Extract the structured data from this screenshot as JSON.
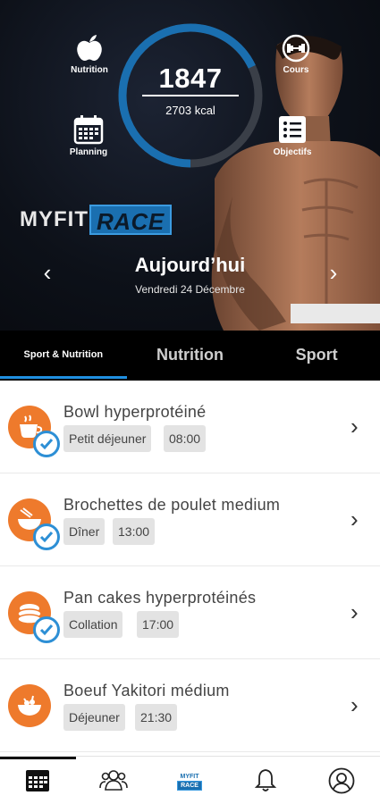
{
  "hero": {
    "calories_consumed": "1847",
    "calories_target": "2703 kcal",
    "progress_fraction": 0.68,
    "shortcuts": {
      "nutrition": "Nutrition",
      "planning": "Planning",
      "cours": "Cours",
      "objectifs": "Objectifs"
    },
    "brand": {
      "part1": "MYFIT",
      "part2": "RACE"
    },
    "day_title": "Aujourd’hui",
    "day_date": "Vendredi 24 Décembre"
  },
  "tabs": [
    {
      "label": "Sport & Nutrition",
      "active": true
    },
    {
      "label": "Nutrition",
      "active": false
    },
    {
      "label": "Sport",
      "active": false
    }
  ],
  "meals": [
    {
      "name": "Bowl hyperprotéiné",
      "type": "Petit déjeuner",
      "time": "08:00",
      "done": true,
      "icon": "cup-icon"
    },
    {
      "name": "Brochettes de poulet medium",
      "type": "Dîner",
      "time": "13:00",
      "done": true,
      "icon": "bowl-icon"
    },
    {
      "name": "Pan cakes hyperprotéinés",
      "type": "Collation",
      "time": "17:00",
      "done": true,
      "icon": "pancake-icon"
    },
    {
      "name": "Boeuf Yakitori médium",
      "type": "Déjeuner",
      "time": "21:30",
      "done": false,
      "icon": "salad-bowl-icon"
    }
  ],
  "bottom_nav": {
    "brand_top": "MYFIT",
    "brand_bottom": "RACE",
    "active": "calendar"
  },
  "colors": {
    "accent": "#1f8fe0",
    "meal_orange": "#ee7a2c",
    "hero_bg": "#0d1119"
  }
}
